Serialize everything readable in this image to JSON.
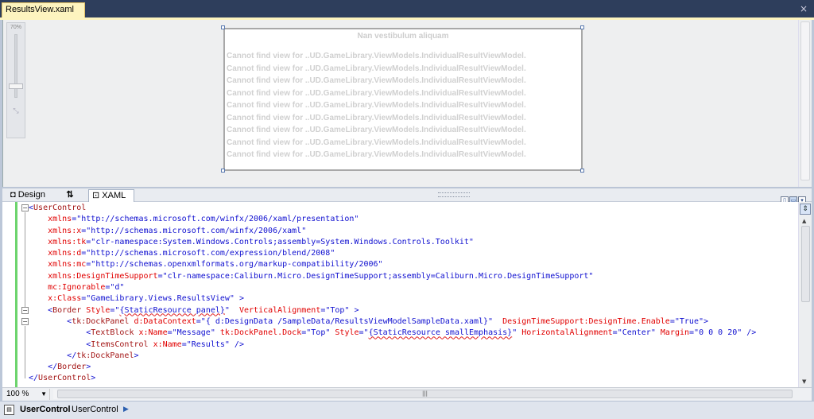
{
  "tab": {
    "title": "ResultsView.xaml",
    "close_glyph": "×"
  },
  "window_close_glyph": "×",
  "zoom_slider": {
    "label": "70%",
    "fit_glyph": "⤡"
  },
  "design_canvas": {
    "title": "Nan vestibulum aliquam",
    "items": [
      "Cannot find view for ..UD.GameLibrary.ViewModels.IndividualResultViewModel.",
      "Cannot find view for ..UD.GameLibrary.ViewModels.IndividualResultViewModel.",
      "Cannot find view for ..UD.GameLibrary.ViewModels.IndividualResultViewModel.",
      "Cannot find view for ..UD.GameLibrary.ViewModels.IndividualResultViewModel.",
      "Cannot find view for ..UD.GameLibrary.ViewModels.IndividualResultViewModel.",
      "Cannot find view for ..UD.GameLibrary.ViewModels.IndividualResultViewModel.",
      "Cannot find view for ..UD.GameLibrary.ViewModels.IndividualResultViewModel.",
      "Cannot find view for ..UD.GameLibrary.ViewModels.IndividualResultViewModel.",
      "Cannot find view for ..UD.GameLibrary.ViewModels.IndividualResultViewModel."
    ]
  },
  "view_tabs": {
    "design": "Design",
    "swap": "⇅",
    "xaml": "XAML"
  },
  "pane_icons": [
    "vertical-split-icon",
    "horizontal-split-icon",
    "collapse-pane-icon"
  ],
  "code_lines": [
    [
      {
        "t": "<",
        "c": "b"
      },
      {
        "t": "UserControl",
        "c": "e"
      }
    ],
    [
      {
        "t": "    "
      },
      {
        "t": "xmlns",
        "c": "a"
      },
      {
        "t": "=",
        "c": "b"
      },
      {
        "t": "\"http://schemas.microsoft.com/winfx/2006/xaml/presentation\"",
        "c": "v"
      }
    ],
    [
      {
        "t": "    "
      },
      {
        "t": "xmlns:x",
        "c": "a"
      },
      {
        "t": "=",
        "c": "b"
      },
      {
        "t": "\"http://schemas.microsoft.com/winfx/2006/xaml\"",
        "c": "v"
      }
    ],
    [
      {
        "t": "    "
      },
      {
        "t": "xmlns:tk",
        "c": "a"
      },
      {
        "t": "=",
        "c": "b"
      },
      {
        "t": "\"clr-namespace:System.Windows.Controls;assembly=System.Windows.Controls.Toolkit\"",
        "c": "v"
      }
    ],
    [
      {
        "t": "    "
      },
      {
        "t": "xmlns:d",
        "c": "a"
      },
      {
        "t": "=",
        "c": "b"
      },
      {
        "t": "\"http://schemas.microsoft.com/expression/blend/2008\"",
        "c": "v"
      }
    ],
    [
      {
        "t": "    "
      },
      {
        "t": "xmlns:mc",
        "c": "a"
      },
      {
        "t": "=",
        "c": "b"
      },
      {
        "t": "\"http://schemas.openxmlformats.org/markup-compatibility/2006\"",
        "c": "v"
      }
    ],
    [
      {
        "t": "    "
      },
      {
        "t": "xmlns:DesignTimeSupport",
        "c": "a"
      },
      {
        "t": "=",
        "c": "b"
      },
      {
        "t": "\"clr-namespace:Caliburn.Micro.DesignTimeSupport;assembly=Caliburn.Micro.DesignTimeSupport\"",
        "c": "v"
      }
    ],
    [
      {
        "t": "    "
      },
      {
        "t": "mc:Ignorable",
        "c": "a"
      },
      {
        "t": "=",
        "c": "b"
      },
      {
        "t": "\"d\"",
        "c": "v"
      }
    ],
    [
      {
        "t": "    "
      },
      {
        "t": "x:Class",
        "c": "a"
      },
      {
        "t": "=",
        "c": "b"
      },
      {
        "t": "\"GameLibrary.Views.ResultsView\"",
        "c": "v"
      },
      {
        "t": " >",
        "c": "b"
      }
    ],
    [
      {
        "t": "    "
      },
      {
        "t": "<",
        "c": "b"
      },
      {
        "t": "Border",
        "c": "e"
      },
      {
        "t": " "
      },
      {
        "t": "Style",
        "c": "a"
      },
      {
        "t": "=",
        "c": "b"
      },
      {
        "t": "\"",
        "c": "v"
      },
      {
        "t": "{StaticResource panel}",
        "c": "sq v"
      },
      {
        "t": "\"",
        "c": "v"
      },
      {
        "t": "  "
      },
      {
        "t": "VerticalAlignment",
        "c": "a"
      },
      {
        "t": "=",
        "c": "b"
      },
      {
        "t": "\"Top\"",
        "c": "v"
      },
      {
        "t": " >",
        "c": "b"
      }
    ],
    [
      {
        "t": "        "
      },
      {
        "t": "<",
        "c": "b"
      },
      {
        "t": "tk:DockPanel",
        "c": "e"
      },
      {
        "t": " "
      },
      {
        "t": "d:DataContext",
        "c": "a"
      },
      {
        "t": "=",
        "c": "b"
      },
      {
        "t": "\"{ d:DesignData /SampleData/ResultsViewModelSampleData.xaml}\"",
        "c": "v"
      },
      {
        "t": "  "
      },
      {
        "t": "DesignTimeSupport:DesignTime.Enable",
        "c": "a"
      },
      {
        "t": "=",
        "c": "b"
      },
      {
        "t": "\"True\"",
        "c": "v"
      },
      {
        "t": ">",
        "c": "b"
      }
    ],
    [
      {
        "t": "            "
      },
      {
        "t": "<",
        "c": "b"
      },
      {
        "t": "TextBlock",
        "c": "e"
      },
      {
        "t": " "
      },
      {
        "t": "x:Name",
        "c": "a"
      },
      {
        "t": "=",
        "c": "b"
      },
      {
        "t": "\"Message\"",
        "c": "v"
      },
      {
        "t": " "
      },
      {
        "t": "tk:DockPanel.Dock",
        "c": "a"
      },
      {
        "t": "=",
        "c": "b"
      },
      {
        "t": "\"Top\"",
        "c": "v"
      },
      {
        "t": " "
      },
      {
        "t": "Style",
        "c": "a"
      },
      {
        "t": "=",
        "c": "b"
      },
      {
        "t": "\"",
        "c": "v"
      },
      {
        "t": "{StaticResource smallEmphasis}",
        "c": "sq v"
      },
      {
        "t": "\"",
        "c": "v"
      },
      {
        "t": " "
      },
      {
        "t": "HorizontalAlignment",
        "c": "a"
      },
      {
        "t": "=",
        "c": "b"
      },
      {
        "t": "\"Center\"",
        "c": "v"
      },
      {
        "t": " "
      },
      {
        "t": "Margin",
        "c": "a"
      },
      {
        "t": "=",
        "c": "b"
      },
      {
        "t": "\"0 0 0 20\"",
        "c": "v"
      },
      {
        "t": " />",
        "c": "b"
      }
    ],
    [
      {
        "t": "            "
      },
      {
        "t": "<",
        "c": "b"
      },
      {
        "t": "ItemsControl",
        "c": "e"
      },
      {
        "t": " "
      },
      {
        "t": "x:Name",
        "c": "a"
      },
      {
        "t": "=",
        "c": "b"
      },
      {
        "t": "\"Results\"",
        "c": "v"
      },
      {
        "t": " />",
        "c": "b"
      }
    ],
    [
      {
        "t": "        "
      },
      {
        "t": "</",
        "c": "b"
      },
      {
        "t": "tk:DockPanel",
        "c": "e"
      },
      {
        "t": ">",
        "c": "b"
      }
    ],
    [
      {
        "t": "    "
      },
      {
        "t": "</",
        "c": "b"
      },
      {
        "t": "Border",
        "c": "e"
      },
      {
        "t": ">",
        "c": "b"
      }
    ],
    [
      {
        "t": "</",
        "c": "b"
      },
      {
        "t": "UserControl",
        "c": "e"
      },
      {
        "t": ">",
        "c": "b"
      }
    ]
  ],
  "outline_glyph": "−",
  "zoom_level": "100 %",
  "hscroll_grip": "|||",
  "breadcrumb": {
    "item1": "UserControl",
    "item2": "UserControl",
    "arrow": "▶"
  },
  "colors": {
    "accent_tab": "#fdf4bf",
    "modified_bar": "#6dd46d",
    "attr": "#e10000",
    "element": "#a31515",
    "value": "#1010d0"
  }
}
